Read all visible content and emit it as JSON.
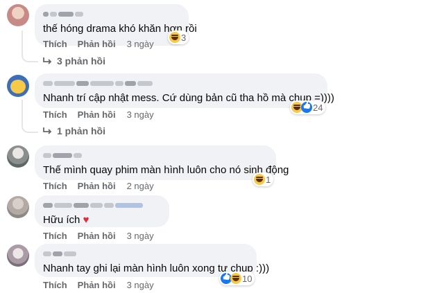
{
  "comments": [
    {
      "text": "thế hóng drama khó khăn hơn rồi",
      "reaction_count": "3",
      "like_label": "Thích",
      "reply_label": "Phản hồi",
      "time": "3 ngày",
      "replies_label": "3 phản hồi"
    },
    {
      "text": "Nhanh trí    cập nhật mess. Cứ dùng bản cũ tha hồ mà chụp =))))",
      "reaction_count": "24",
      "like_label": "Thích",
      "reply_label": "Phản hồi",
      "time": "3 ngày",
      "replies_label": "1 phản hồi"
    },
    {
      "text": "Thế mình quay phim màn hình luôn cho nó sinh động",
      "reaction_count": "1",
      "like_label": "Thích",
      "reply_label": "Phản hồi",
      "time": "2 ngày"
    },
    {
      "text": "Hữu ích",
      "heart": "♥",
      "like_label": "Thích",
      "reply_label": "Phản hồi",
      "time": "3 ngày"
    },
    {
      "text": "Nhanh tay ghi lại màn hình luôn xong tự chụp :)))",
      "reaction_count": "10",
      "like_label": "Thích",
      "reply_label": "Phản hồi",
      "time": "3 ngày"
    }
  ],
  "icons": {
    "haha": "haha-reaction-icon",
    "like": "like-reaction-icon",
    "reply": "reply-arrow-icon"
  },
  "colors": {
    "bubble": "#f0f2f5",
    "secondary_text": "#65676b",
    "heart": "#e02b3a",
    "like_blue": "#1877f2",
    "haha_yellow": "#f7c948"
  }
}
